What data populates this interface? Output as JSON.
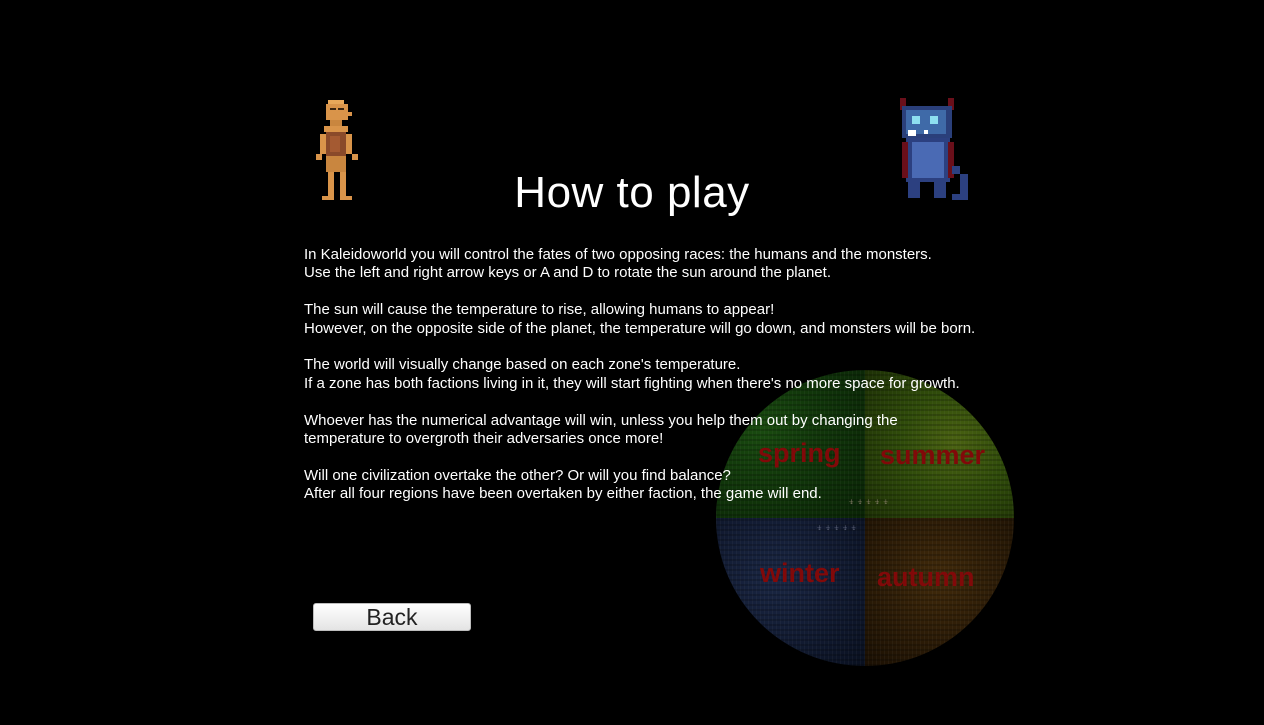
{
  "title": "How to play",
  "paragraphs": [
    [
      "In Kaleidoworld you will control the fates of two opposing races: the humans and the monsters.",
      "Use the left and right arrow keys or A and D to rotate the sun around the planet."
    ],
    [
      "The sun will cause the temperature to rise, allowing humans to appear!",
      "However, on the opposite side of the planet, the temperature will go down, and monsters will be born."
    ],
    [
      "The world will visually change based on each zone's temperature.",
      "If a zone has both factions living in it, they will start fighting when there's no more space for growth."
    ],
    [
      "Whoever has the numerical advantage will win, unless you help them out by changing the temperature to overgroth their adversaries once more!"
    ],
    [
      "Will one civilization overtake the other? Or will you find balance?",
      "After all four regions have been overtaken by either faction, the game will end."
    ]
  ],
  "planet": {
    "seasons": {
      "spring": "spring",
      "summer": "summer",
      "winter": "winter",
      "autumn": "autumn"
    },
    "season_color": "#d01010"
  },
  "back_button": "Back",
  "icons": {
    "human": "human-sprite-icon",
    "monster": "monster-sprite-icon"
  }
}
